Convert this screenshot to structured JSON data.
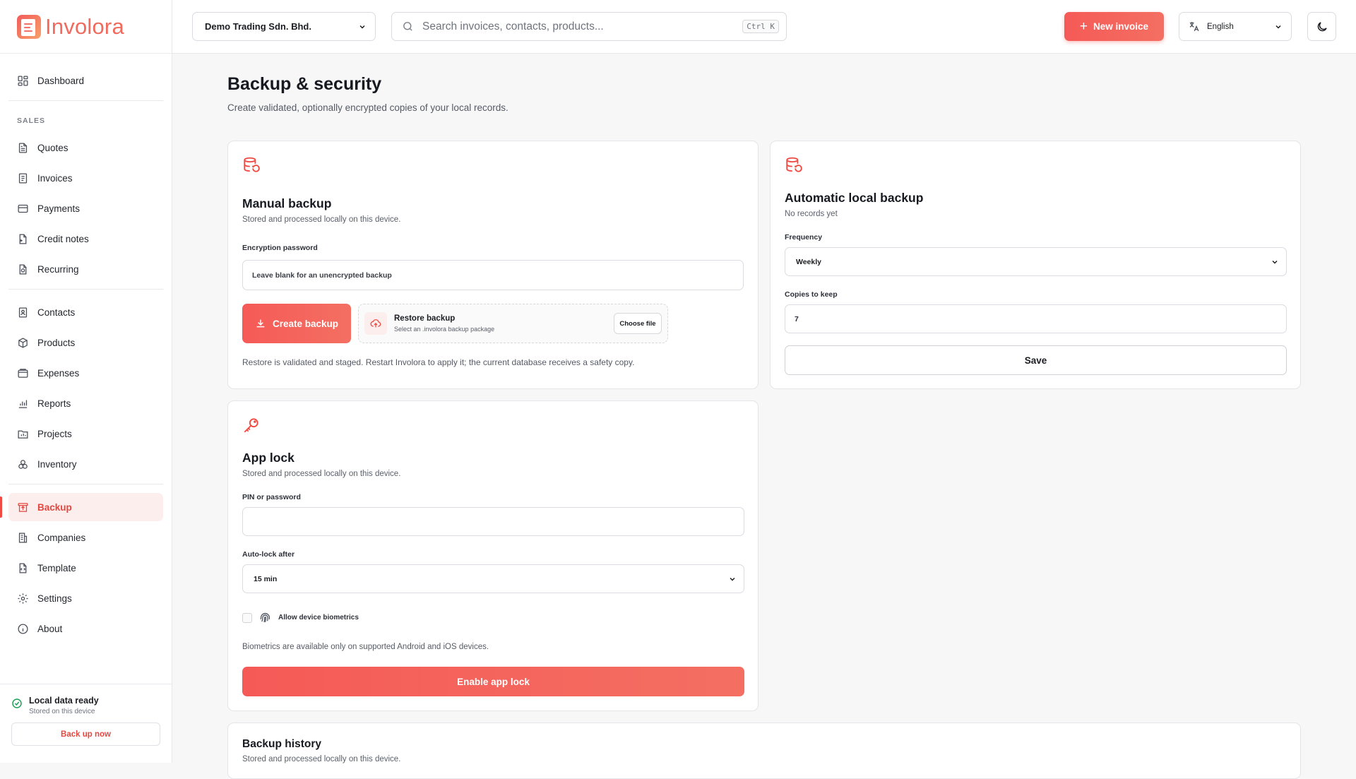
{
  "app": {
    "name": "Involora"
  },
  "header": {
    "company": "Demo Trading Sdn. Bhd.",
    "search_placeholder": "Search invoices, contacts, products...",
    "shortcut": "Ctrl K",
    "new_invoice": "New invoice",
    "language": "English"
  },
  "sidebar": {
    "dashboard": "Dashboard",
    "section_sales": "SALES",
    "items": {
      "quotes": "Quotes",
      "invoices": "Invoices",
      "payments": "Payments",
      "credit_notes": "Credit notes",
      "recurring": "Recurring",
      "contacts": "Contacts",
      "products": "Products",
      "expenses": "Expenses",
      "reports": "Reports",
      "projects": "Projects",
      "inventory": "Inventory",
      "backup": "Backup",
      "companies": "Companies",
      "template": "Template",
      "settings": "Settings",
      "about": "About"
    },
    "status_title": "Local data ready",
    "status_sub": "Stored on this device",
    "backup_now": "Back up now"
  },
  "page": {
    "title": "Backup & security",
    "subtitle": "Create validated, optionally encrypted copies of your local records."
  },
  "manual": {
    "title": "Manual backup",
    "subtitle": "Stored and processed locally on this device.",
    "password_label": "Encryption password",
    "password_placeholder": "Leave blank for an unencrypted backup",
    "create": "Create backup",
    "restore_title": "Restore backup",
    "restore_sub": "Select an .involora backup package",
    "choose_file": "Choose file",
    "note": "Restore is validated and staged. Restart Involora to apply it; the current database receives a safety copy."
  },
  "auto": {
    "title": "Automatic local backup",
    "subtitle": "No records yet",
    "frequency_label": "Frequency",
    "frequency_value": "Weekly",
    "copies_label": "Copies to keep",
    "copies_value": "7",
    "save": "Save"
  },
  "lock": {
    "title": "App lock",
    "subtitle": "Stored and processed locally on this device.",
    "pin_label": "PIN or password",
    "autolock_label": "Auto-lock after",
    "autolock_value": "15 min",
    "biometrics_label": "Allow device biometrics",
    "note": "Biometrics are available only on supported Android and iOS devices.",
    "enable": "Enable app lock"
  },
  "history": {
    "title": "Backup history",
    "subtitle": "Stored and processed locally on this device."
  },
  "colors": {
    "accent": "#ef4b43",
    "accent_soft": "#fdeeee",
    "success": "#21a05a"
  }
}
